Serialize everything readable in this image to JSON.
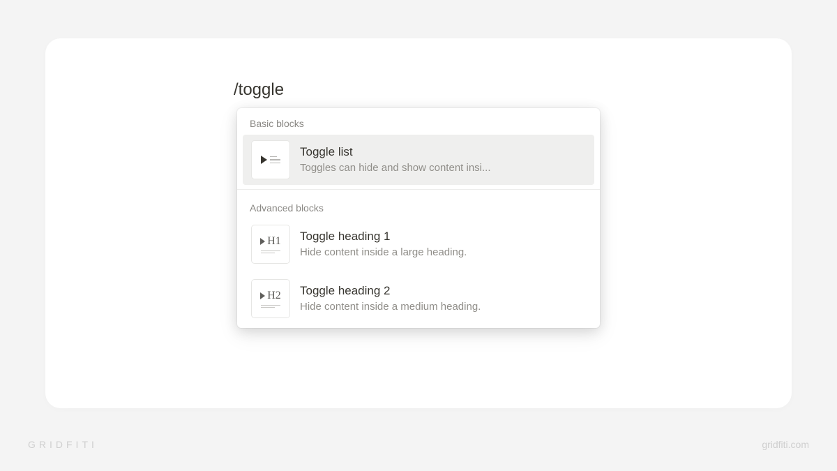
{
  "command_input": "/toggle",
  "menu": {
    "sections": [
      {
        "label": "Basic blocks",
        "items": [
          {
            "title": "Toggle list",
            "description": "Toggles can hide and show content insi...",
            "icon": "toggle-list-icon",
            "highlighted": true
          }
        ]
      },
      {
        "label": "Advanced blocks",
        "items": [
          {
            "title": "Toggle heading 1",
            "description": "Hide content inside a large heading.",
            "icon": "toggle-h1-icon",
            "icon_text": "H1",
            "highlighted": false
          },
          {
            "title": "Toggle heading 2",
            "description": "Hide content inside a medium heading.",
            "icon": "toggle-h2-icon",
            "icon_text": "H2",
            "highlighted": false
          }
        ]
      }
    ]
  },
  "watermark": {
    "brand": "GRIDFITI",
    "url": "gridfiti.com"
  }
}
